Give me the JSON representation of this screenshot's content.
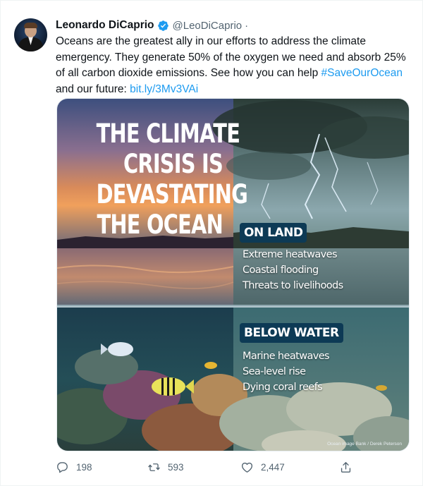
{
  "tweet": {
    "author_name": "Leonardo DiCaprio",
    "handle": "@LeoDiCaprio",
    "separator": "·",
    "text_main": "Oceans are the greatest ally in our efforts to address the climate emergency. They generate 50% of the oxygen we need and absorb 25% of all carbon dioxide emissions. See how you can help ",
    "hashtag": "#SaveOurOcean",
    "text_after_hashtag": " and our future: ",
    "link": "bit.ly/3Mv3VAi"
  },
  "media": {
    "headline_lines": [
      "THE CLIMATE",
      "CRISIS IS",
      "DEVASTATING",
      "THE OCEAN"
    ],
    "land_heading": "ON LAND",
    "land_items": [
      "Extreme heatwaves",
      "Coastal flooding",
      "Threats to livelihoods"
    ],
    "water_heading": "BELOW WATER",
    "water_items": [
      "Marine heatwaves",
      "Sea-level rise",
      "Dying coral reefs"
    ],
    "credit": "Ocean image Bank / Derek Peterson"
  },
  "actions": {
    "reply_count": "198",
    "retweet_count": "593",
    "like_count": "2,447"
  },
  "colors": {
    "link": "#1d9bf0",
    "verified": "#1d9bf0",
    "muted": "#536471",
    "badge_bg": "#0d3a55"
  },
  "icons": [
    "verified-badge-icon",
    "reply-icon",
    "retweet-icon",
    "like-icon",
    "share-icon"
  ]
}
